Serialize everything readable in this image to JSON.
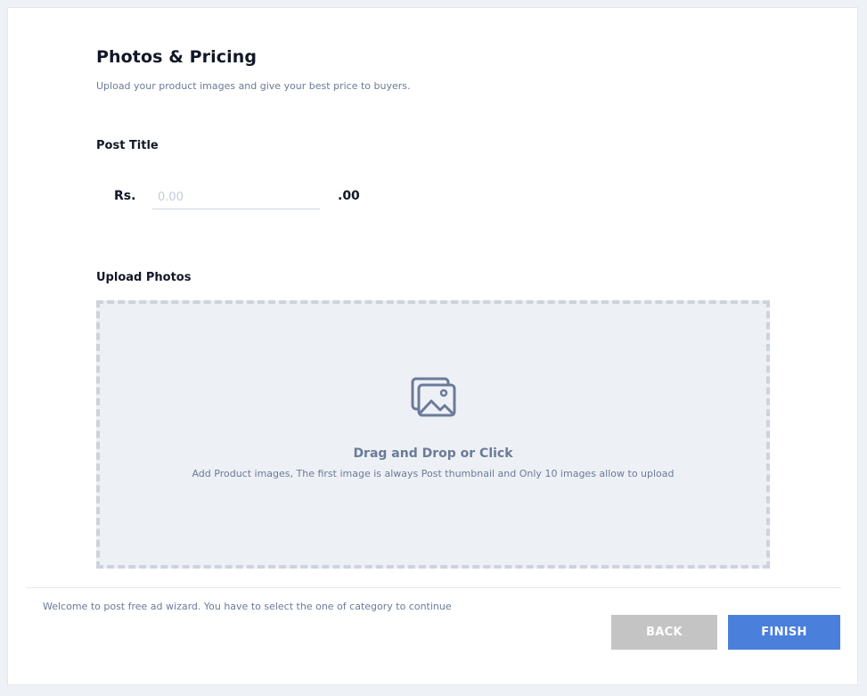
{
  "header": {
    "title": "Photos & Pricing",
    "subtitle": "Upload your product images and give your best price to buyers."
  },
  "pricing": {
    "label": "Post Title",
    "currency_prefix": "Rs.",
    "placeholder": "0.00",
    "value": "",
    "decimal_suffix": ".00"
  },
  "upload": {
    "label": "Upload Photos",
    "icon": "images-icon",
    "title": "Drag and Drop or Click",
    "hint": "Add Product images, The first image is always Post thumbnail and Only 10 images allow to upload"
  },
  "footer": {
    "note": "Welcome to post free ad wizard. You have to select the one of category to continue",
    "back_label": "BACK",
    "finish_label": "FINISH"
  },
  "colors": {
    "primary": "#4a7fdb",
    "disabled": "#c4c4c4",
    "muted_text": "#6b7a99",
    "dropzone_bg": "#edf1f6"
  }
}
